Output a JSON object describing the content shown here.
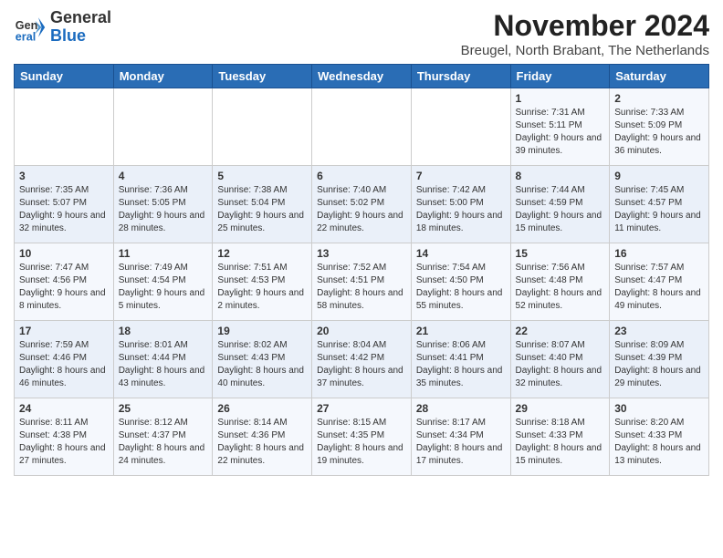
{
  "logo": {
    "text_general": "General",
    "text_blue": "Blue"
  },
  "header": {
    "month_title": "November 2024",
    "location": "Breugel, North Brabant, The Netherlands"
  },
  "weekdays": [
    "Sunday",
    "Monday",
    "Tuesday",
    "Wednesday",
    "Thursday",
    "Friday",
    "Saturday"
  ],
  "weeks": [
    [
      {
        "day": "",
        "info": ""
      },
      {
        "day": "",
        "info": ""
      },
      {
        "day": "",
        "info": ""
      },
      {
        "day": "",
        "info": ""
      },
      {
        "day": "",
        "info": ""
      },
      {
        "day": "1",
        "info": "Sunrise: 7:31 AM\nSunset: 5:11 PM\nDaylight: 9 hours and 39 minutes."
      },
      {
        "day": "2",
        "info": "Sunrise: 7:33 AM\nSunset: 5:09 PM\nDaylight: 9 hours and 36 minutes."
      }
    ],
    [
      {
        "day": "3",
        "info": "Sunrise: 7:35 AM\nSunset: 5:07 PM\nDaylight: 9 hours and 32 minutes."
      },
      {
        "day": "4",
        "info": "Sunrise: 7:36 AM\nSunset: 5:05 PM\nDaylight: 9 hours and 28 minutes."
      },
      {
        "day": "5",
        "info": "Sunrise: 7:38 AM\nSunset: 5:04 PM\nDaylight: 9 hours and 25 minutes."
      },
      {
        "day": "6",
        "info": "Sunrise: 7:40 AM\nSunset: 5:02 PM\nDaylight: 9 hours and 22 minutes."
      },
      {
        "day": "7",
        "info": "Sunrise: 7:42 AM\nSunset: 5:00 PM\nDaylight: 9 hours and 18 minutes."
      },
      {
        "day": "8",
        "info": "Sunrise: 7:44 AM\nSunset: 4:59 PM\nDaylight: 9 hours and 15 minutes."
      },
      {
        "day": "9",
        "info": "Sunrise: 7:45 AM\nSunset: 4:57 PM\nDaylight: 9 hours and 11 minutes."
      }
    ],
    [
      {
        "day": "10",
        "info": "Sunrise: 7:47 AM\nSunset: 4:56 PM\nDaylight: 9 hours and 8 minutes."
      },
      {
        "day": "11",
        "info": "Sunrise: 7:49 AM\nSunset: 4:54 PM\nDaylight: 9 hours and 5 minutes."
      },
      {
        "day": "12",
        "info": "Sunrise: 7:51 AM\nSunset: 4:53 PM\nDaylight: 9 hours and 2 minutes."
      },
      {
        "day": "13",
        "info": "Sunrise: 7:52 AM\nSunset: 4:51 PM\nDaylight: 8 hours and 58 minutes."
      },
      {
        "day": "14",
        "info": "Sunrise: 7:54 AM\nSunset: 4:50 PM\nDaylight: 8 hours and 55 minutes."
      },
      {
        "day": "15",
        "info": "Sunrise: 7:56 AM\nSunset: 4:48 PM\nDaylight: 8 hours and 52 minutes."
      },
      {
        "day": "16",
        "info": "Sunrise: 7:57 AM\nSunset: 4:47 PM\nDaylight: 8 hours and 49 minutes."
      }
    ],
    [
      {
        "day": "17",
        "info": "Sunrise: 7:59 AM\nSunset: 4:46 PM\nDaylight: 8 hours and 46 minutes."
      },
      {
        "day": "18",
        "info": "Sunrise: 8:01 AM\nSunset: 4:44 PM\nDaylight: 8 hours and 43 minutes."
      },
      {
        "day": "19",
        "info": "Sunrise: 8:02 AM\nSunset: 4:43 PM\nDaylight: 8 hours and 40 minutes."
      },
      {
        "day": "20",
        "info": "Sunrise: 8:04 AM\nSunset: 4:42 PM\nDaylight: 8 hours and 37 minutes."
      },
      {
        "day": "21",
        "info": "Sunrise: 8:06 AM\nSunset: 4:41 PM\nDaylight: 8 hours and 35 minutes."
      },
      {
        "day": "22",
        "info": "Sunrise: 8:07 AM\nSunset: 4:40 PM\nDaylight: 8 hours and 32 minutes."
      },
      {
        "day": "23",
        "info": "Sunrise: 8:09 AM\nSunset: 4:39 PM\nDaylight: 8 hours and 29 minutes."
      }
    ],
    [
      {
        "day": "24",
        "info": "Sunrise: 8:11 AM\nSunset: 4:38 PM\nDaylight: 8 hours and 27 minutes."
      },
      {
        "day": "25",
        "info": "Sunrise: 8:12 AM\nSunset: 4:37 PM\nDaylight: 8 hours and 24 minutes."
      },
      {
        "day": "26",
        "info": "Sunrise: 8:14 AM\nSunset: 4:36 PM\nDaylight: 8 hours and 22 minutes."
      },
      {
        "day": "27",
        "info": "Sunrise: 8:15 AM\nSunset: 4:35 PM\nDaylight: 8 hours and 19 minutes."
      },
      {
        "day": "28",
        "info": "Sunrise: 8:17 AM\nSunset: 4:34 PM\nDaylight: 8 hours and 17 minutes."
      },
      {
        "day": "29",
        "info": "Sunrise: 8:18 AM\nSunset: 4:33 PM\nDaylight: 8 hours and 15 minutes."
      },
      {
        "day": "30",
        "info": "Sunrise: 8:20 AM\nSunset: 4:33 PM\nDaylight: 8 hours and 13 minutes."
      }
    ]
  ]
}
